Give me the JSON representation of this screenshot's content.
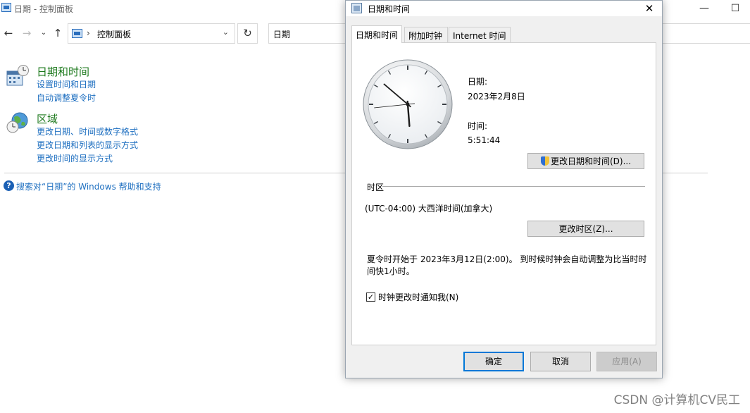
{
  "background_window": {
    "title": "日期 - 控制面板",
    "address": {
      "path": "控制面板",
      "separator": "›"
    },
    "search_value": "日期",
    "categories": [
      {
        "title": "日期和时间",
        "links": [
          "设置时间和日期",
          "自动调整夏令时"
        ]
      },
      {
        "title": "区域",
        "links": [
          "更改日期、时间或数字格式",
          "更改日期和列表的显示方式",
          "更改时间的显示方式"
        ]
      }
    ],
    "help_text": "搜索对“日期”的 Windows 帮助和支持"
  },
  "dialog": {
    "title": "日期和时间",
    "tabs": [
      "日期和时间",
      "附加时钟",
      "Internet 时间"
    ],
    "active_tab": 0,
    "date_label": "日期:",
    "date_value": "2023年2月8日",
    "time_label": "时间:",
    "time_value": "5:51:44",
    "change_datetime_button": "更改日期和时间(D)...",
    "timezone_section": "时区",
    "timezone_value": "(UTC-04:00) 大西洋时间(加拿大)",
    "change_timezone_button": "更改时区(Z)...",
    "dst_note_line1": "夏令时开始于 2023年3月12日(2:00)。 到时候时钟会自动调整为比当时时",
    "dst_note_line2": "间快1小时。",
    "notify_checkbox_label": "时钟更改时通知我(N)",
    "notify_checked": true,
    "ok_button": "确定",
    "cancel_button": "取消",
    "apply_button": "应用(A)",
    "clock": {
      "hour": 5,
      "minute": 51,
      "second": 44
    }
  },
  "watermark": "CSDN @计算机CV民工",
  "colors": {
    "category_title": "#1e7a1e",
    "link": "#1e6fc0",
    "primary_border": "#0078d7"
  }
}
